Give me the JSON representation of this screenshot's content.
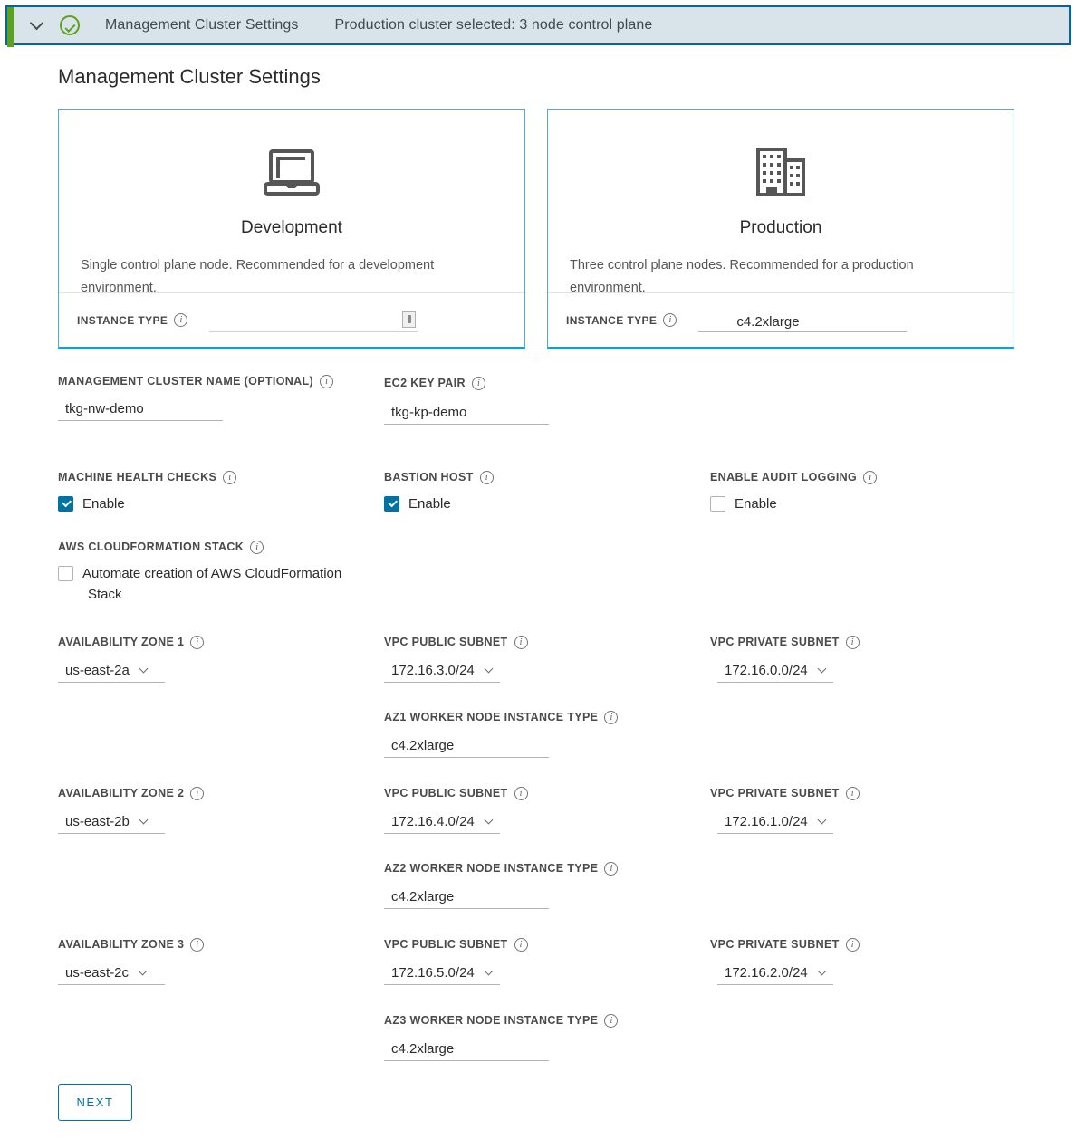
{
  "header": {
    "step_title": "Management Cluster Settings",
    "step_status": "Production cluster selected: 3 node control plane",
    "chevron_icon": "chevron-down-icon",
    "check_icon": "circle-check-icon",
    "accent_color": "#5aa220",
    "border_color": "#0065ab",
    "background": "#d9e4ea"
  },
  "page_title": "Management Cluster Settings",
  "cards": {
    "development": {
      "name": "Development",
      "icon": "laptop-icon",
      "description": "Single control plane node. Recommended for a development environment.",
      "instance_type_label": "INSTANCE TYPE",
      "instance_type_value": "",
      "instance_type_disabled_icon": "blocked-icon",
      "selected": false
    },
    "production": {
      "name": "Production",
      "icon": "office-building-icon",
      "description": "Three control plane nodes. Recommended for a production environment.",
      "instance_type_label": "INSTANCE TYPE",
      "instance_type_value": "c4.2xlarge",
      "selected": true
    },
    "accent_color": "#1a9bd7"
  },
  "form": {
    "cluster_name": {
      "label": "MANAGEMENT CLUSTER NAME (OPTIONAL)",
      "value": "tkg-nw-demo"
    },
    "ec2_key_pair": {
      "label": "EC2 KEY PAIR",
      "value": "tkg-kp-demo"
    },
    "machine_health_checks": {
      "label": "MACHINE HEALTH CHECKS",
      "checkbox_label": "Enable",
      "checked": true
    },
    "bastion_host": {
      "label": "BASTION HOST",
      "checkbox_label": "Enable",
      "checked": true
    },
    "enable_audit_logging": {
      "label": "ENABLE AUDIT LOGGING",
      "checkbox_label": "Enable",
      "checked": false
    },
    "cloudformation_stack": {
      "label": "AWS CLOUDFORMATION STACK",
      "checkbox_label": "Automate creation of AWS CloudFormation Stack",
      "checked": false
    },
    "zones": [
      {
        "az_label": "AVAILABILITY ZONE 1",
        "az_value": "us-east-2a",
        "public_subnet_label": "VPC PUBLIC SUBNET",
        "public_subnet_value": "172.16.3.0/24",
        "private_subnet_label": "VPC PRIVATE SUBNET",
        "private_subnet_value": "172.16.0.0/24",
        "worker_label": "AZ1 WORKER NODE INSTANCE TYPE",
        "worker_value": "c4.2xlarge"
      },
      {
        "az_label": "AVAILABILITY ZONE 2",
        "az_value": "us-east-2b",
        "public_subnet_label": "VPC PUBLIC SUBNET",
        "public_subnet_value": "172.16.4.0/24",
        "private_subnet_label": "VPC PRIVATE SUBNET",
        "private_subnet_value": "172.16.1.0/24",
        "worker_label": "AZ2 WORKER NODE INSTANCE TYPE",
        "worker_value": "c4.2xlarge"
      },
      {
        "az_label": "AVAILABILITY ZONE 3",
        "az_value": "us-east-2c",
        "public_subnet_label": "VPC PUBLIC SUBNET",
        "public_subnet_value": "172.16.5.0/24",
        "private_subnet_label": "VPC PRIVATE SUBNET",
        "private_subnet_value": "172.16.2.0/24",
        "worker_label": "AZ3 WORKER NODE INSTANCE TYPE",
        "worker_value": "c4.2xlarge"
      }
    ]
  },
  "next_button": {
    "label": "NEXT",
    "color": "#0072a3"
  },
  "info_glyph": "i"
}
